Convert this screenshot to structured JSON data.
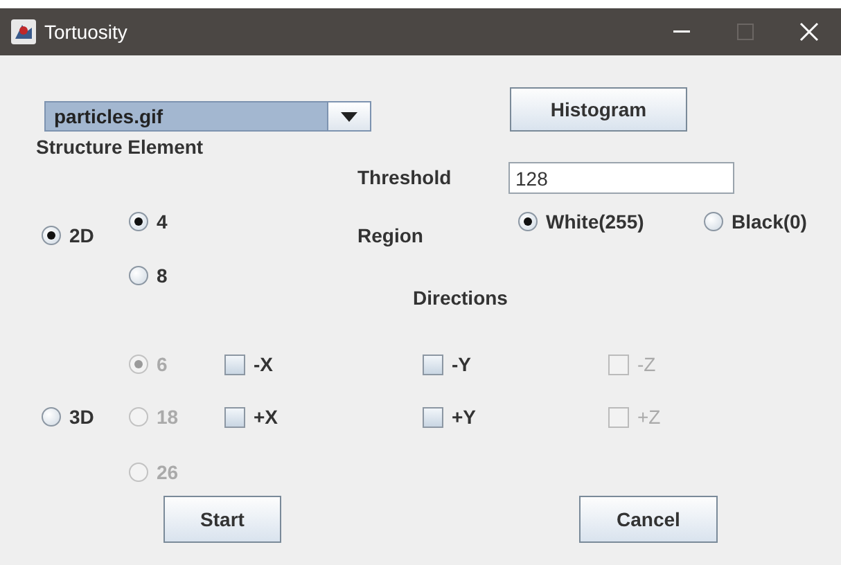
{
  "window": {
    "title": "Tortuosity"
  },
  "file_select": {
    "value": "particles.gif"
  },
  "histogram_button": "Histogram",
  "structure_element": {
    "label": "Structure Element",
    "dimension": [
      {
        "label": "2D",
        "selected": true
      },
      {
        "label": "3D",
        "selected": false
      }
    ],
    "connectivity_2d": [
      {
        "label": "4",
        "selected": true,
        "disabled": false
      },
      {
        "label": "8",
        "selected": false,
        "disabled": false
      }
    ],
    "connectivity_3d": [
      {
        "label": "6",
        "selected": true,
        "disabled": true
      },
      {
        "label": "18",
        "selected": false,
        "disabled": true
      },
      {
        "label": "26",
        "selected": false,
        "disabled": true
      }
    ]
  },
  "threshold": {
    "label": "Threshold",
    "value": "128"
  },
  "region": {
    "label": "Region",
    "options": [
      {
        "label": "White(255)",
        "selected": true
      },
      {
        "label": "Black(0)",
        "selected": false
      }
    ]
  },
  "directions": {
    "label": "Directions",
    "options": [
      {
        "label": "-X",
        "checked": false,
        "disabled": false
      },
      {
        "label": "+X",
        "checked": false,
        "disabled": false
      },
      {
        "label": "-Y",
        "checked": false,
        "disabled": false
      },
      {
        "label": "+Y",
        "checked": false,
        "disabled": false
      },
      {
        "label": "-Z",
        "checked": false,
        "disabled": true
      },
      {
        "label": "+Z",
        "checked": false,
        "disabled": true
      }
    ]
  },
  "buttons": [
    "Start",
    "Cancel"
  ]
}
